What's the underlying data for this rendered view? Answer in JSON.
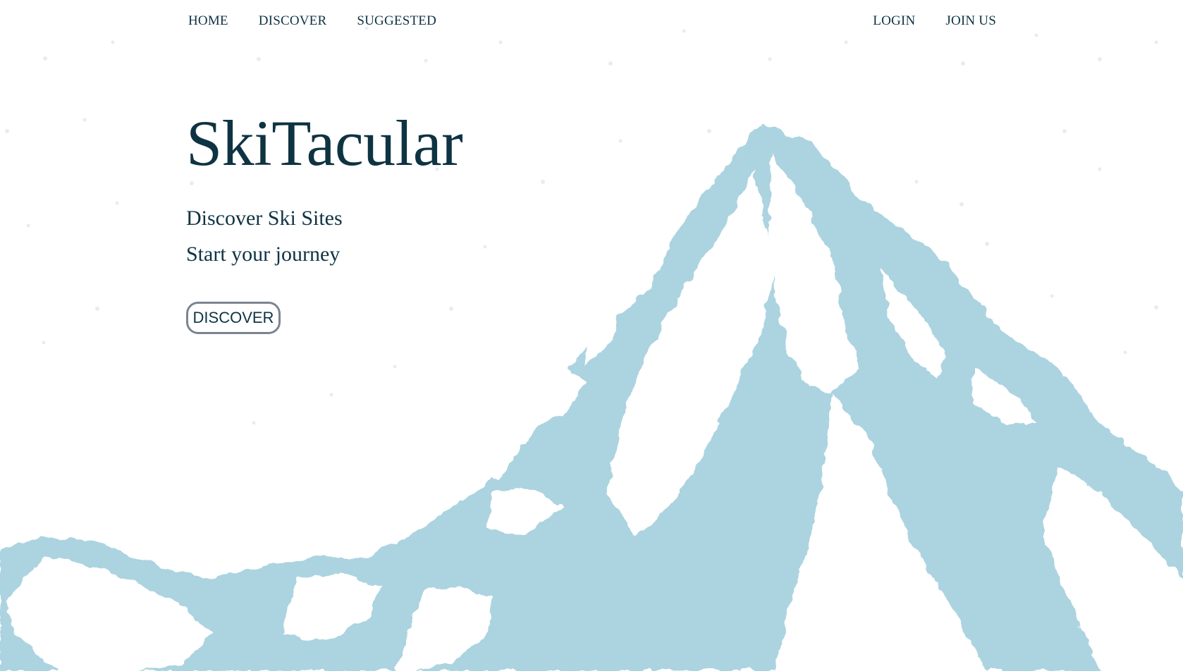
{
  "nav": {
    "left": [
      {
        "label": "HOME",
        "name": "nav-home-link"
      },
      {
        "label": "DISCOVER",
        "name": "nav-discover-link"
      },
      {
        "label": "SUGGESTED",
        "name": "nav-suggested-link"
      }
    ],
    "right": [
      {
        "label": "LOGIN",
        "name": "nav-login-link"
      },
      {
        "label": "JOIN US",
        "name": "nav-join-us-link"
      }
    ]
  },
  "hero": {
    "title": "SkiTacular",
    "tagline_1": "Discover Ski Sites",
    "tagline_2": "Start your journey",
    "cta_label": "DISCOVER"
  },
  "colors": {
    "text": "#0f3344",
    "mountain": "#acd3e0",
    "snow_speck": "#e3eef3",
    "button_border": "#7b8592",
    "background": "#ffffff"
  }
}
